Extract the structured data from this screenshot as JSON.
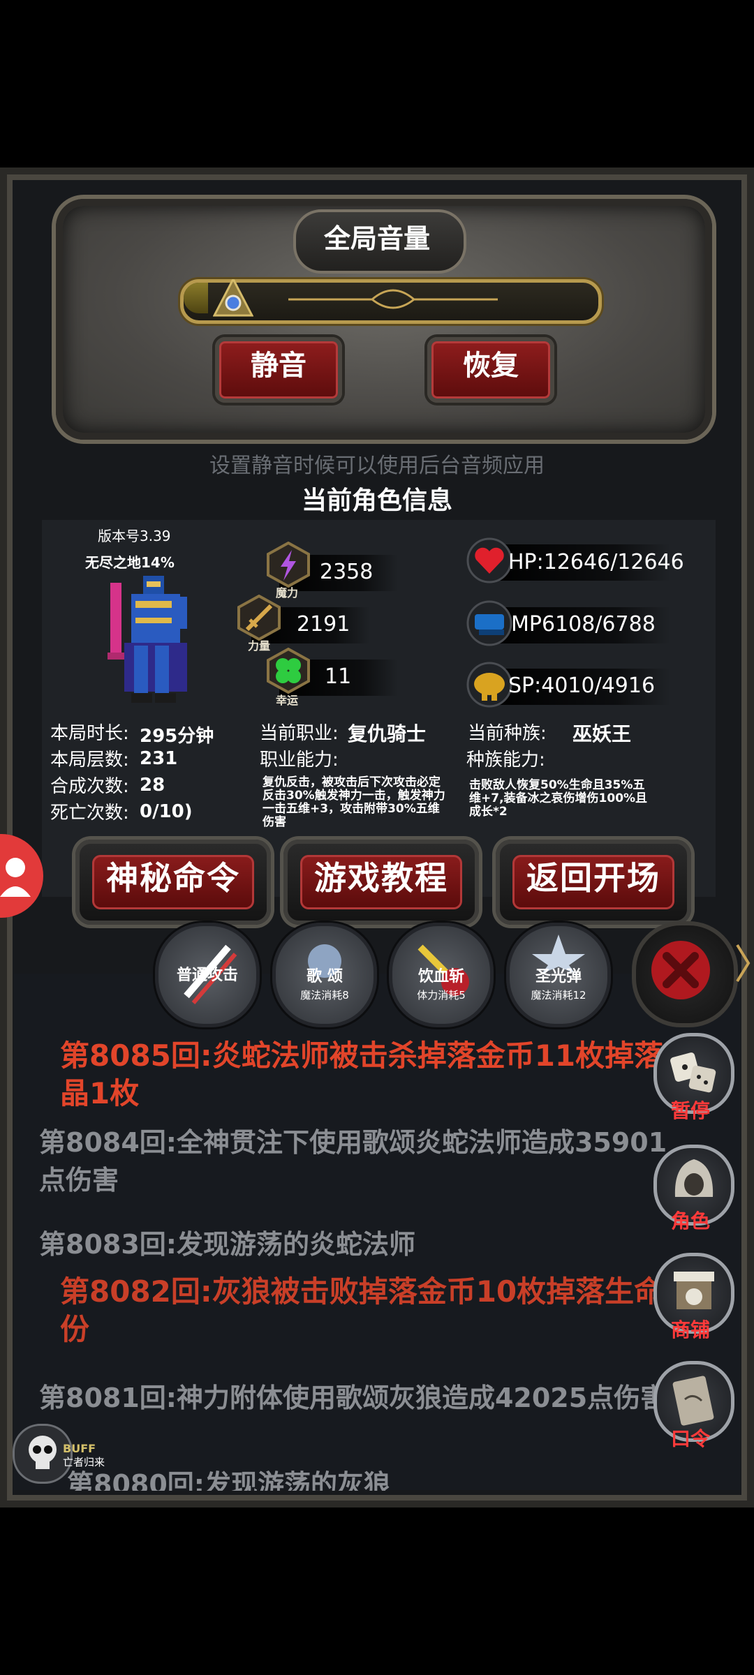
{
  "volume": {
    "title": "全局音量",
    "level_fraction": 0.06,
    "mute_label": "静音",
    "restore_label": "恢复",
    "hint": "设置静音时候可以使用后台音频应用"
  },
  "character": {
    "section_title": "当前角色信息",
    "version": "版本号3.39",
    "zone": "无尽之地14%",
    "stats": {
      "magic": {
        "badge": "魔力",
        "value": "2358"
      },
      "strength": {
        "badge": "力量",
        "value": "2191"
      },
      "luck": {
        "badge": "幸运",
        "value": "11"
      }
    },
    "vitals": {
      "hp": "HP:12646/12646",
      "mp": "MP6108/6788",
      "sp": "SP:4010/4916"
    },
    "run_info": {
      "time_label": "本局时长:",
      "time_value": "295分钟",
      "floors_label": "本局层数:",
      "floors_value": "231",
      "craft_label": "合成次数:",
      "craft_value": "28",
      "death_label": "死亡次数:",
      "death_value": "0/10)"
    },
    "job": {
      "label": "当前职业:",
      "value": "复仇骑士",
      "ability_label": "职业能力:",
      "ability_desc": "复仇反击，被攻击后下次攻击必定反击30%触发神力一击，触发神力一击五维+3，攻击附带30%五维伤害"
    },
    "race": {
      "label": "当前种族:",
      "value": "巫妖王",
      "ability_label": "种族能力:",
      "ability_desc": "击败敌人恢复50%生命且35%五维+7,装备冰之哀伤增伤100%且成长*2"
    },
    "buttons": {
      "secret": "神秘命令",
      "tutorial": "游戏教程",
      "back": "返回开场"
    }
  },
  "skills": [
    {
      "name": "普通攻击",
      "cost": ""
    },
    {
      "name": "歌 颂",
      "cost": "魔法消耗8"
    },
    {
      "name": "饮血斩",
      "cost": "体力消耗5"
    },
    {
      "name": "圣光弹",
      "cost": "魔法消耗12"
    }
  ],
  "log": [
    {
      "text": "第8085回:炎蛇法师被击杀掉落金币11枚掉落晶1枚",
      "style": "red"
    },
    {
      "text": "第8084回:全神贯注下使用歌颂炎蛇法师造成35901点伤害",
      "style": "grey"
    },
    {
      "text": "第8083回:发现游荡的炎蛇法师",
      "style": "grey"
    },
    {
      "text": "第8082回:灰狼被击败掉落金币10枚掉落生命份",
      "style": "red"
    },
    {
      "text": "第8081回:神力附体使用歌颂灰狼造成42025点伤害",
      "style": "grey"
    },
    {
      "text": "第8080回:发现游荡的灰狼",
      "style": "grey"
    }
  ],
  "side_menu": {
    "pause": "暂停",
    "role": "角色",
    "shop": "商铺",
    "command": "口令"
  },
  "buff": {
    "line1": "BUFF",
    "line2": "亡者归来"
  },
  "colors": {
    "accent_red": "#e2452a",
    "gold": "#b79a4e",
    "log_grey": "#8b8e93"
  }
}
